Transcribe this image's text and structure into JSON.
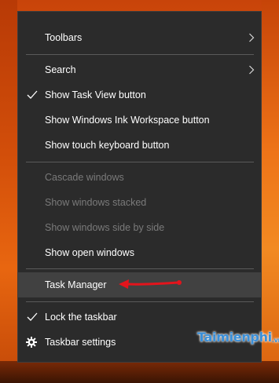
{
  "menu": {
    "toolbars": "Toolbars",
    "search": "Search",
    "show_task_view": "Show Task View button",
    "show_ink_workspace": "Show Windows Ink Workspace button",
    "show_touch_keyboard": "Show touch keyboard button",
    "cascade_windows": "Cascade windows",
    "show_stacked": "Show windows stacked",
    "show_side_by_side": "Show windows side by side",
    "show_open_windows": "Show open windows",
    "task_manager": "Task Manager",
    "lock_taskbar": "Lock the taskbar",
    "taskbar_settings": "Taskbar settings"
  },
  "states": {
    "show_task_view_checked": true,
    "lock_taskbar_checked": true,
    "cascade_enabled": false,
    "stacked_enabled": false,
    "side_by_side_enabled": false
  },
  "icons": {
    "submenu": "chevron-right-icon",
    "check": "checkmark-icon",
    "settings": "gear-icon",
    "annotation": "red-arrow-icon"
  },
  "colors": {
    "menu_bg": "#2b2b2b",
    "highlight_bg": "#414141",
    "text": "#ffffff",
    "disabled_text": "#7a7a7a",
    "annotation": "#e3141c",
    "watermark": "#3a8fd8"
  },
  "watermark": {
    "brand": "Taimienphi",
    "suffix": ".vn"
  }
}
